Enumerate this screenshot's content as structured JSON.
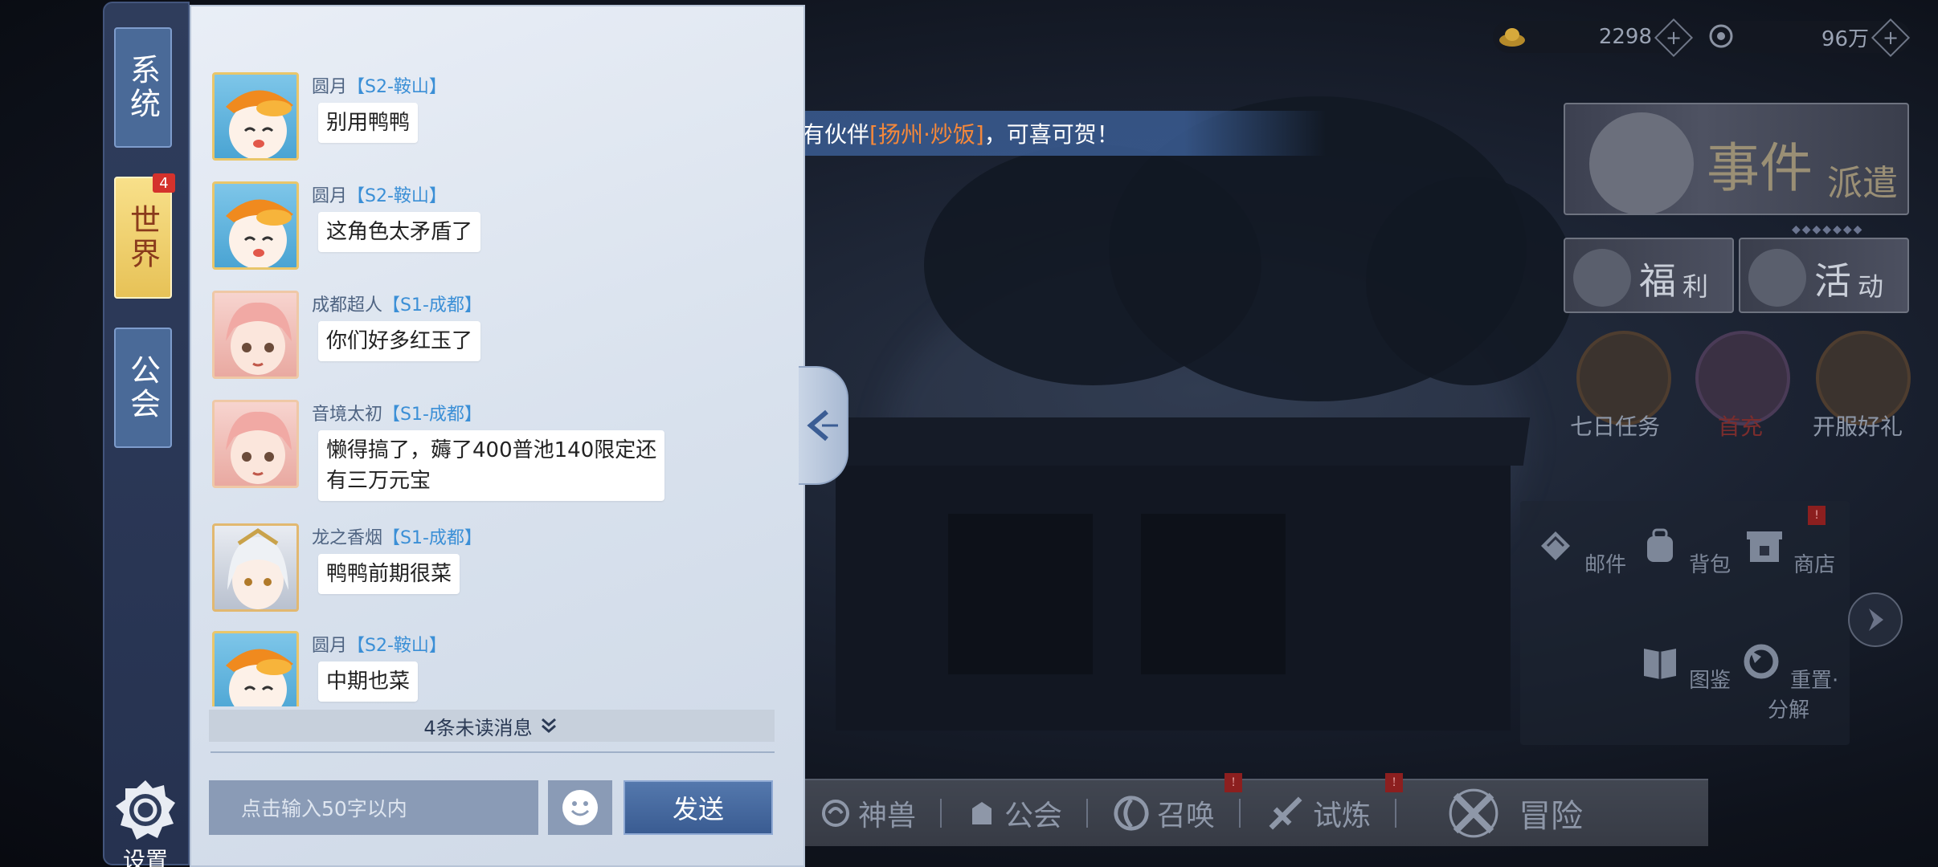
{
  "tabs": [
    {
      "label": "系统"
    },
    {
      "label": "世界",
      "badge": "4",
      "active": true
    },
    {
      "label": "公会"
    }
  ],
  "settings_label": "设置",
  "messages": [
    {
      "name": "圆月",
      "server": "【S2-鞍山】",
      "text": "别用鸭鸭",
      "avatar": "duck-avatar"
    },
    {
      "name": "圆月",
      "server": "【S2-鞍山】",
      "text": "这角色太矛盾了",
      "avatar": "duck-avatar"
    },
    {
      "name": "成都超人",
      "server": "【S1-成都】",
      "text": "你们好多红玉了",
      "avatar": "pink-hair-avatar"
    },
    {
      "name": "音境太初",
      "server": "【S1-成都】",
      "text_line1": "懒得搞了，薅了400普池140限定还",
      "text_line2": "有三万元宝",
      "avatar": "pink-hair-avatar"
    },
    {
      "name": "龙之香烟",
      "server": "【S1-成都】",
      "text": "鸭鸭前期很菜",
      "avatar": "white-hair-avatar"
    },
    {
      "name": "圆月",
      "server": "【S2-鞍山】",
      "text": "中期也菜",
      "avatar": "duck-avatar"
    }
  ],
  "unread": "4条未读消息",
  "input_placeholder": "点击输入50字以内",
  "send_label": "发送",
  "broadcast": {
    "prefix": "召唤，获得了稀有伙伴",
    "highlight": "[扬州·炒饭]",
    "suffix": "，可喜可贺！",
    "highlight_color": "#f5883a"
  },
  "currency": [
    {
      "icon": "gold-ingot-icon",
      "value": "2298"
    },
    {
      "icon": "coin-icon",
      "value": "96万"
    }
  ],
  "banner": {
    "title_big": "事件",
    "title_small": "派遣"
  },
  "half_buttons": [
    {
      "big": "福",
      "small": "利"
    },
    {
      "big": "活",
      "small": "动"
    }
  ],
  "round_buttons": [
    "七日任务",
    "首充",
    "开服好礼"
  ],
  "functions": [
    {
      "label": "邮件",
      "icon": "mail-icon"
    },
    {
      "label": "背包",
      "icon": "bag-icon"
    },
    {
      "label": "商店",
      "icon": "shop-icon",
      "badge": "!"
    },
    {
      "label": "图鉴",
      "icon": "book-icon"
    },
    {
      "label": "重置·分解",
      "icon": "recycle-icon"
    }
  ],
  "bottom_nav": [
    {
      "label": "神兽",
      "icon": "beast-icon"
    },
    {
      "label": "公会",
      "icon": "guild-icon"
    },
    {
      "label": "召唤",
      "icon": "summon-icon",
      "badge": "!"
    },
    {
      "label": "试炼",
      "icon": "trial-icon",
      "badge": "!"
    },
    {
      "label": "冒险",
      "icon": "adventure-icon"
    }
  ],
  "colors": {
    "accent_blue": "#3b8fd6",
    "panel_bg": "#e2e9f3",
    "tab_active": "#e7c257",
    "badge_red": "#d4322c"
  }
}
